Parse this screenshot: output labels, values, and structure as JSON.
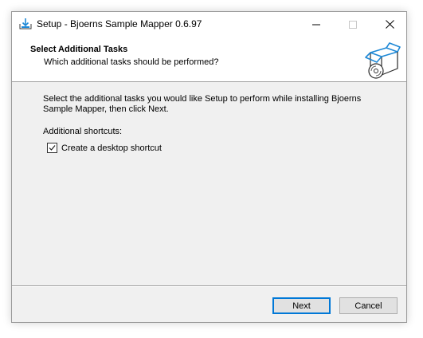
{
  "window": {
    "title": "Setup - Bjoerns Sample Mapper 0.6.97",
    "controls": {
      "minimize": "minimize-icon",
      "maximize": "maximize-icon",
      "close": "close-icon"
    }
  },
  "header": {
    "title": "Select Additional Tasks",
    "subtitle": "Which additional tasks should be performed?",
    "image": "install-box-cd-icon"
  },
  "content": {
    "description": "Select the additional tasks you would like Setup to perform while installing Bjoerns Sample Mapper, then click Next.",
    "group_label": "Additional shortcuts:",
    "tasks": [
      {
        "label": "Create a desktop shortcut",
        "checked": true
      }
    ]
  },
  "buttons": {
    "next": "Next",
    "cancel": "Cancel"
  },
  "colors": {
    "accent": "#0078d7",
    "window_bg": "#f0f0f0",
    "icon_blue": "#1e88d6"
  }
}
